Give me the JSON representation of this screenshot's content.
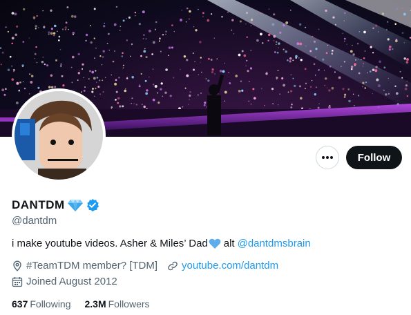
{
  "profile": {
    "display_name": "DANTDM",
    "name_emoji": "gem-icon",
    "verified": true,
    "handle": "@dantdm",
    "bio_text": "i make youtube videos. Asher & Miles’ Dad",
    "bio_emoji": "blue-heart-icon",
    "bio_alt": "alt",
    "bio_link": "@dantdmsbrain",
    "location": "#TeamTDM member? [TDM]",
    "website": "youtube.com/dantdm",
    "joined": "Joined August 2012"
  },
  "stats": {
    "following_count": "637",
    "following_label": "Following",
    "followers_count": "2.3M",
    "followers_label": "Followers"
  },
  "actions": {
    "more_icon": "more-icon",
    "follow_label": "Follow"
  },
  "colors": {
    "accent": "#1d9bf0",
    "text": "#0f1419",
    "secondary": "#536471",
    "button_dark": "#0f1419"
  }
}
